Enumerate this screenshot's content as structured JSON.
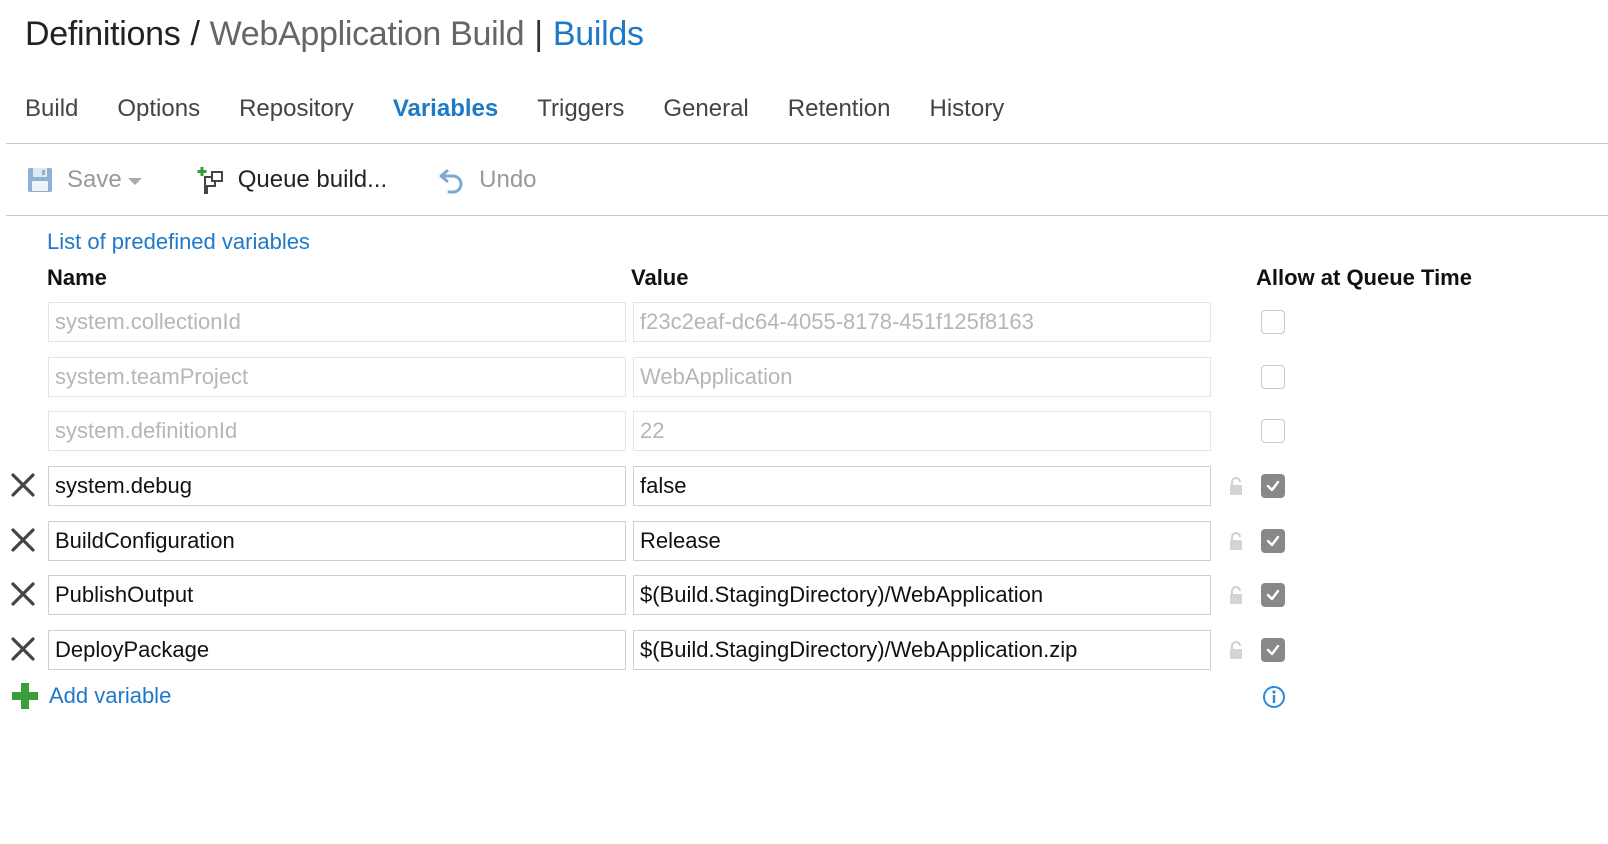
{
  "header": {
    "root": "Definitions",
    "separator": "/",
    "current": "WebApplication Build",
    "pipe": "|",
    "link": "Builds"
  },
  "tabs": [
    {
      "label": "Build",
      "active": false
    },
    {
      "label": "Options",
      "active": false
    },
    {
      "label": "Repository",
      "active": false
    },
    {
      "label": "Variables",
      "active": true
    },
    {
      "label": "Triggers",
      "active": false
    },
    {
      "label": "General",
      "active": false
    },
    {
      "label": "Retention",
      "active": false
    },
    {
      "label": "History",
      "active": false
    }
  ],
  "toolbar": {
    "save_label": "Save",
    "save_icon": "floppy-disk-icon",
    "queue_label": "Queue build...",
    "queue_icon": "queue-build-icon",
    "undo_label": "Undo",
    "undo_icon": "undo-icon"
  },
  "variables": {
    "predefined_link": "List of predefined variables",
    "columns": {
      "name": "Name",
      "value": "Value",
      "queue_time": "Allow at Queue Time"
    },
    "rows": [
      {
        "name": "system.collectionId",
        "value": "f23c2eaf-dc64-4055-8178-451f125f8163",
        "readonly": true,
        "allow_queue": false
      },
      {
        "name": "system.teamProject",
        "value": "WebApplication",
        "readonly": true,
        "allow_queue": false
      },
      {
        "name": "system.definitionId",
        "value": "22",
        "readonly": true,
        "allow_queue": false
      },
      {
        "name": "system.debug",
        "value": "false",
        "readonly": false,
        "allow_queue": true
      },
      {
        "name": "BuildConfiguration",
        "value": "Release",
        "readonly": false,
        "allow_queue": true
      },
      {
        "name": "PublishOutput",
        "value": "$(Build.StagingDirectory)/WebApplication",
        "readonly": false,
        "allow_queue": true
      },
      {
        "name": "DeployPackage",
        "value": "$(Build.StagingDirectory)/WebApplication.zip",
        "readonly": false,
        "allow_queue": true
      }
    ],
    "add_label": "Add variable"
  },
  "colors": {
    "accent": "#1e79c8",
    "add_green": "#3a9d3a",
    "checkbox_checked": "#888888"
  }
}
